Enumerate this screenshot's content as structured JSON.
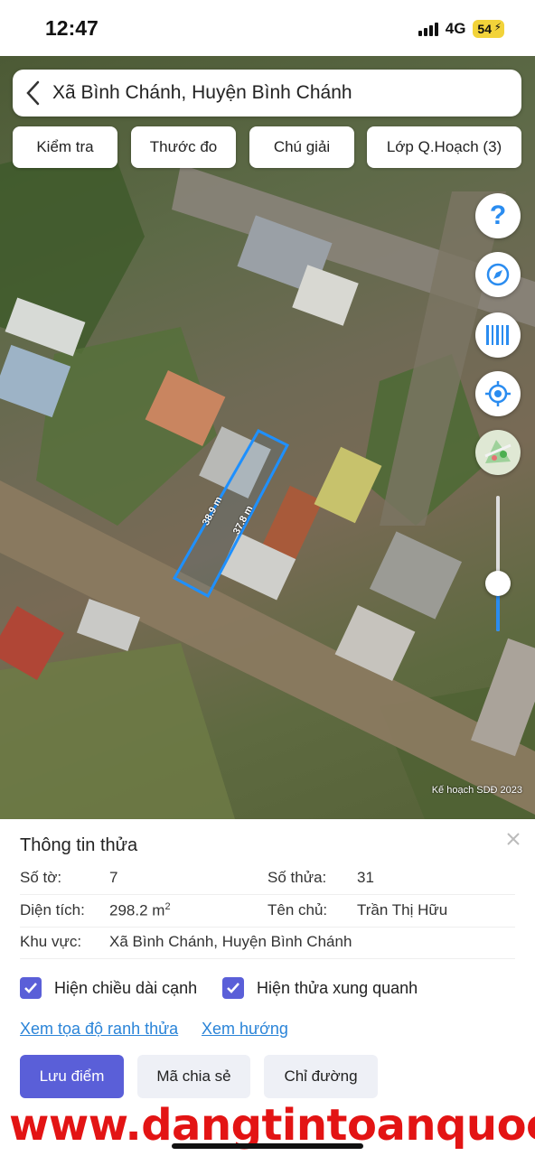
{
  "status_bar": {
    "time": "12:47",
    "network": "4G",
    "battery": "54"
  },
  "search": {
    "location": "Xã Bình Chánh, Huyện Bình Chánh"
  },
  "toolbar": {
    "check_label": "Kiểm tra",
    "measure_label": "Thước đo",
    "legend_label": "Chú giải",
    "layers_label": "Lớp Q.Hoạch (3)"
  },
  "map": {
    "help_glyph": "?",
    "measure_left": "38.9 m",
    "measure_right": "37.8 m",
    "attribution": "Kế hoạch SDĐ 2023",
    "zoom_level_fraction": 0.35,
    "icons": [
      "help-icon",
      "compass-icon",
      "barcode-icon",
      "locate-icon",
      "map-layer-icon"
    ]
  },
  "sheet": {
    "title": "Thông tin thửa",
    "so_to_label": "Số tờ:",
    "so_to_value": "7",
    "so_thua_label": "Số thửa:",
    "so_thua_value": "31",
    "dien_tich_label": "Diện tích:",
    "dien_tich_value": "298.2 m",
    "dien_tich_unit_sup": "2",
    "ten_chu_label": "Tên chủ:",
    "ten_chu_value": "Trần Thị Hữu",
    "khu_vuc_label": "Khu vực:",
    "khu_vuc_value": "Xã Bình Chánh, Huyện Bình Chánh",
    "checkbox_edge_length": "Hiện chiều dài cạnh",
    "checkbox_neighbors": "Hiện thửa xung quanh",
    "link_coordinates": "Xem tọa độ ranh thửa",
    "link_direction": "Xem hướng",
    "btn_save": "Lưu điểm",
    "btn_share": "Mã chia sẻ",
    "btn_directions": "Chỉ đường"
  },
  "watermark": "www.dangtintoanquoc.",
  "colors": {
    "accent": "#5a5fd8",
    "link": "#2a84d8",
    "plot_outline": "#1e90ff",
    "watermark": "#e31414"
  }
}
